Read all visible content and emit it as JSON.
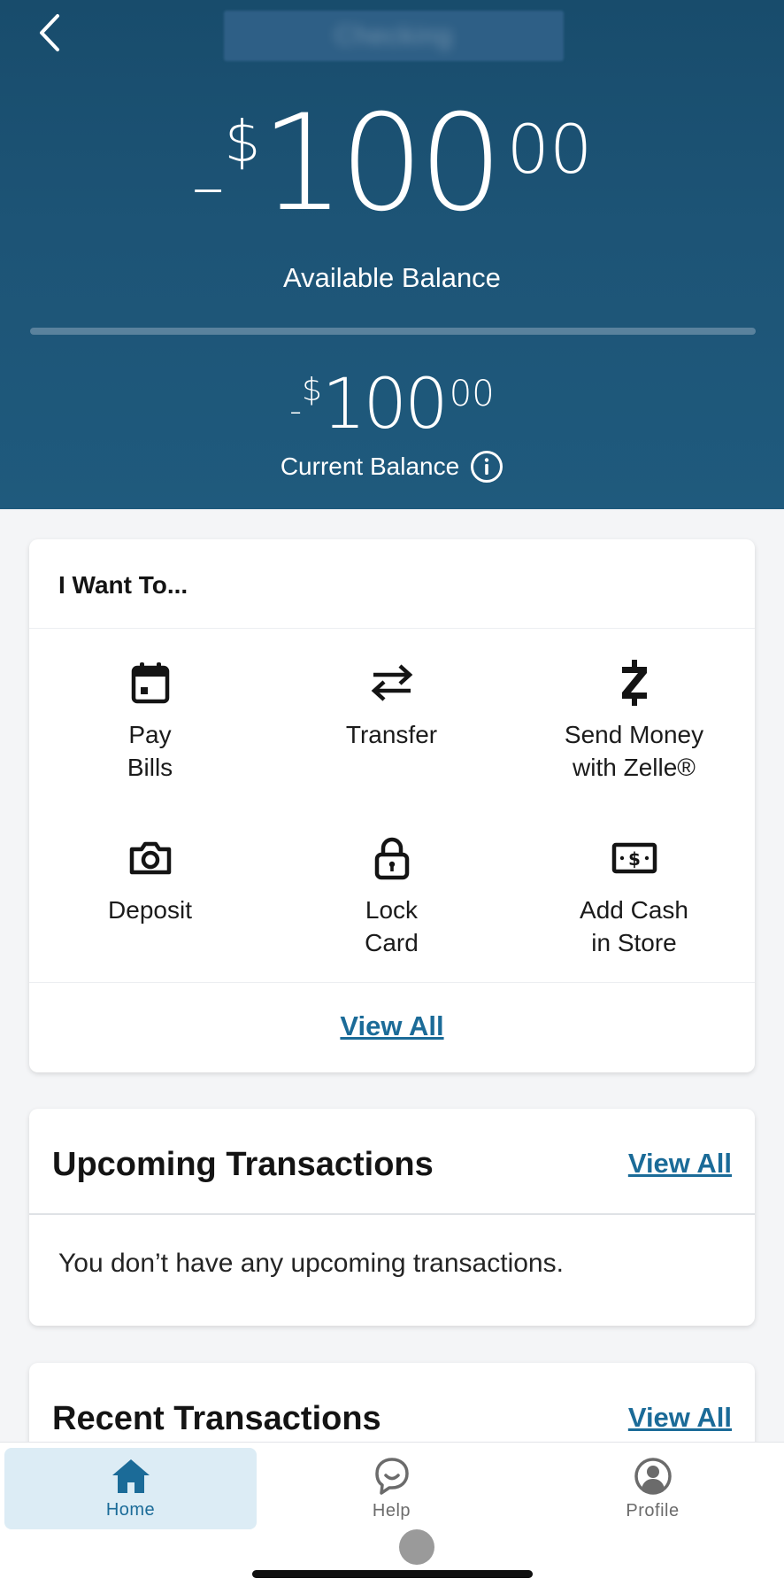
{
  "header": {
    "account_name": "Checking ",
    "available_balance": {
      "sign": "–",
      "dollar": "$",
      "whole": "100",
      "cents": "00"
    },
    "available_label": "Available Balance",
    "current_balance": {
      "sign": "-",
      "dollar": "$",
      "whole": "100",
      "cents": "00"
    },
    "current_label": "Current Balance"
  },
  "i_want_to": {
    "title": "I Want To...",
    "actions": [
      {
        "label": "Pay\nBills",
        "icon": "calendar-icon"
      },
      {
        "label": "Transfer",
        "icon": "transfer-arrows-icon"
      },
      {
        "label": "Send Money\nwith Zelle®",
        "icon": "zelle-icon"
      },
      {
        "label": "Deposit",
        "icon": "camera-icon"
      },
      {
        "label": "Lock\nCard",
        "icon": "lock-icon"
      },
      {
        "label": "Add Cash\nin Store",
        "icon": "cash-icon"
      }
    ],
    "view_all": "View All"
  },
  "upcoming": {
    "title": "Upcoming Transactions",
    "view_all": "View All",
    "empty_message": "You don’t have any upcoming transactions."
  },
  "recent": {
    "title": "Recent Transactions",
    "view_all": "View All"
  },
  "bottom_nav": {
    "items": [
      {
        "label": "Home",
        "icon": "home-icon",
        "active": true
      },
      {
        "label": "Help",
        "icon": "chat-bubble-icon",
        "active": false
      },
      {
        "label": "Profile",
        "icon": "profile-icon",
        "active": false
      }
    ]
  },
  "colors": {
    "header_bg": "#1d5476",
    "link": "#1b6b98",
    "nav_active_bg": "#dcecf5"
  }
}
